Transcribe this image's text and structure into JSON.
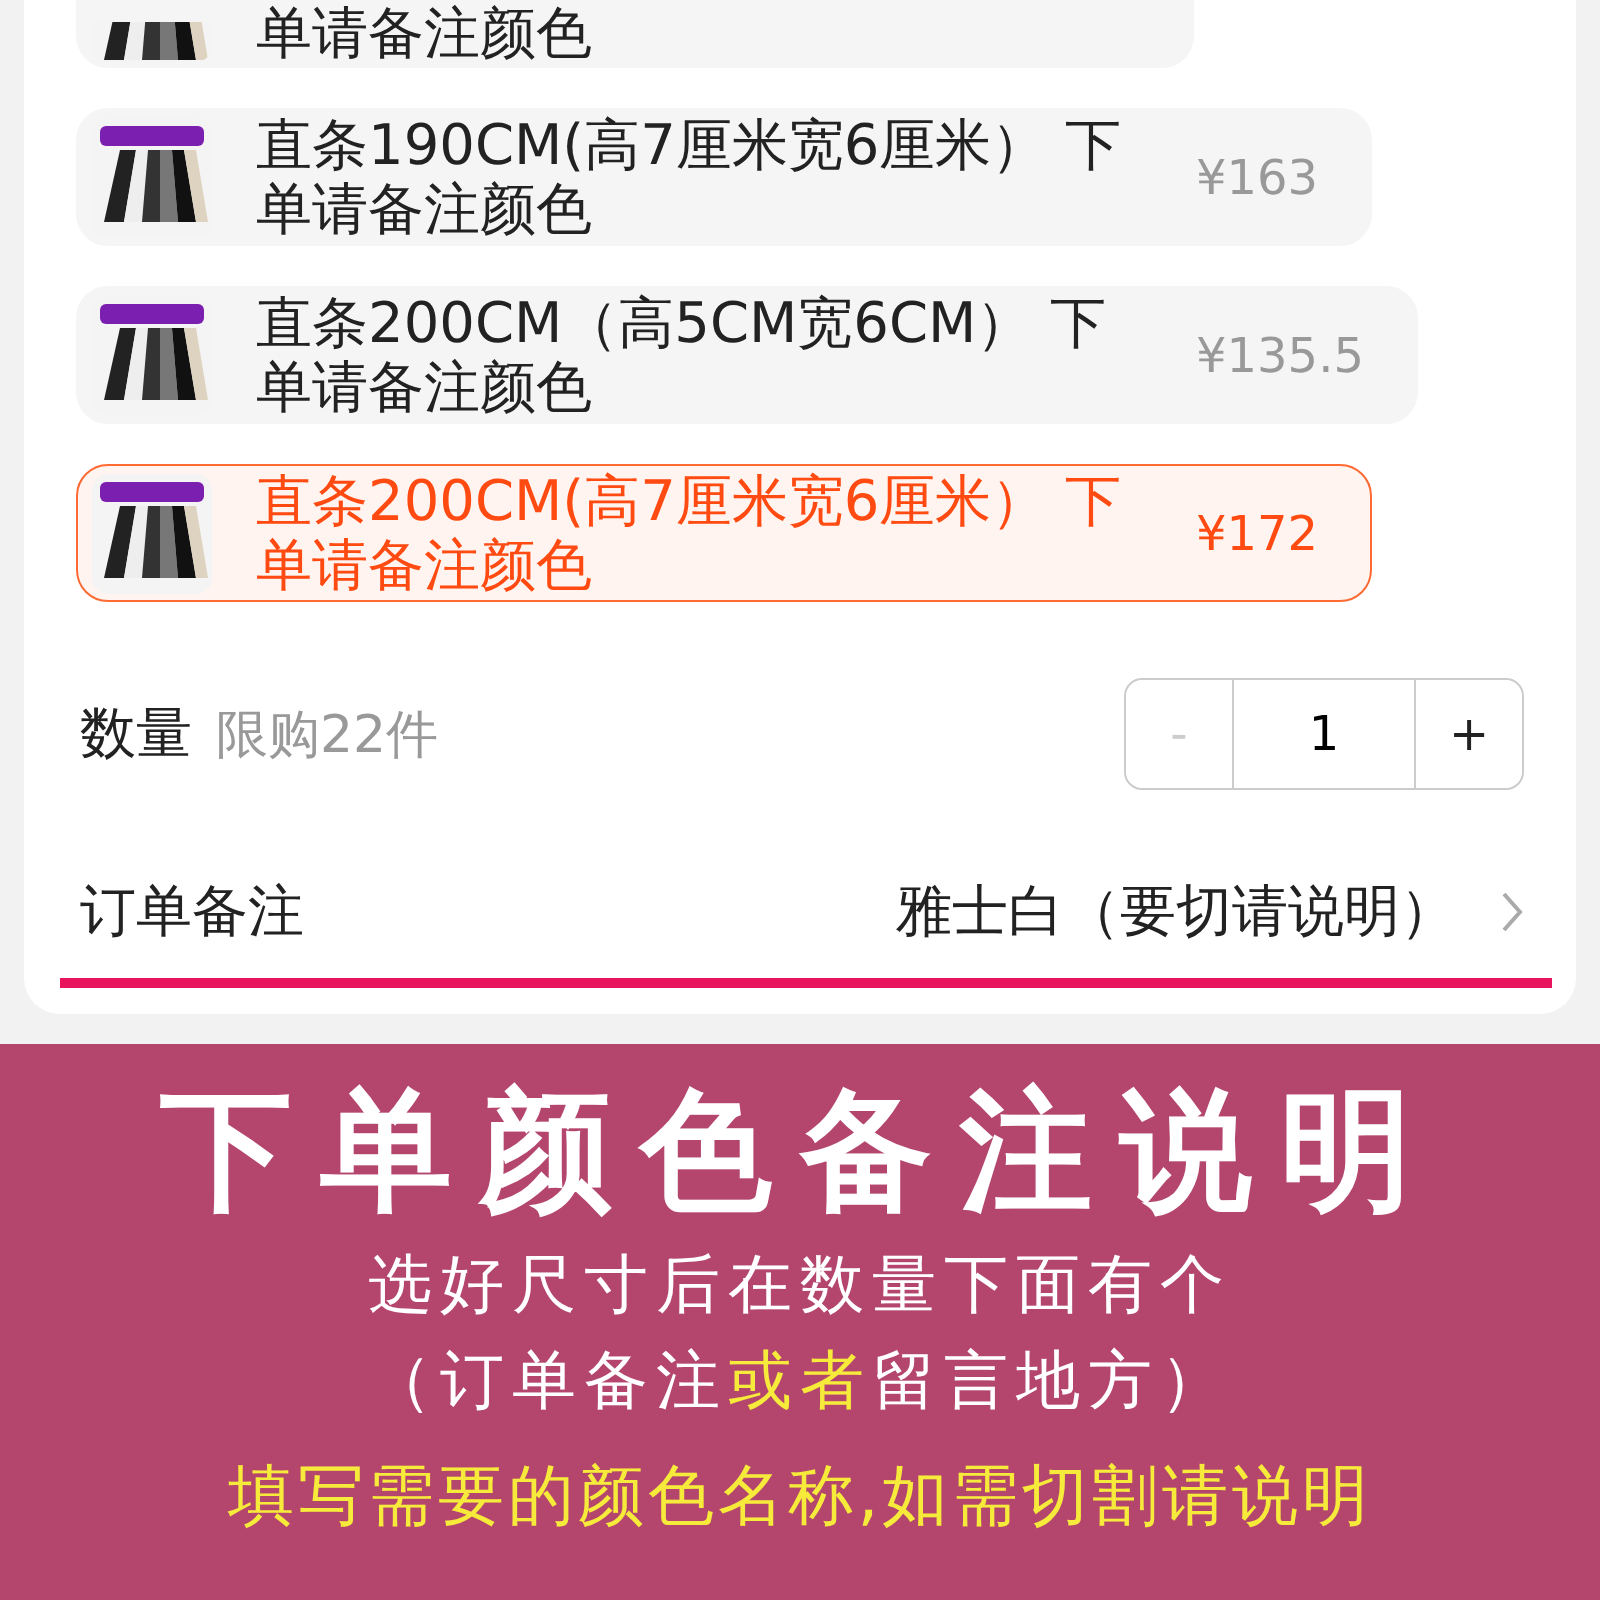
{
  "options": [
    {
      "name": "单请备注颜色",
      "selected": false
    },
    {
      "name": "直条190CM(高7厘米宽6厘米） 下单请备注颜色",
      "price": "¥163",
      "selected": false
    },
    {
      "name": "直条200CM（高5CM宽6CM） 下单请备注颜色",
      "price": "¥135.5",
      "selected": false
    },
    {
      "name": "直条200CM(高7厘米宽6厘米） 下单请备注颜色",
      "price": "¥172",
      "selected": true
    }
  ],
  "quantity": {
    "label": "数量",
    "limit": "限购22件",
    "minus": {
      "label": "-",
      "disabled": true
    },
    "value": "1",
    "plus": {
      "label": "+",
      "disabled": false
    }
  },
  "order_note": {
    "label": "订单备注",
    "value": "雅士白（要切请说明）"
  },
  "banner": {
    "title": "下单颜色备注说明",
    "lines": [
      {
        "parts": [
          {
            "text": "选好尺寸后在数量下面有个",
            "highlight": false
          }
        ]
      },
      {
        "parts": [
          {
            "text": "（订单备注",
            "highlight": false
          },
          {
            "text": "或者",
            "highlight": true
          },
          {
            "text": "留言地方）",
            "highlight": false
          }
        ]
      }
    ],
    "note": "填写需要的颜色名称,如需切割请说明"
  }
}
